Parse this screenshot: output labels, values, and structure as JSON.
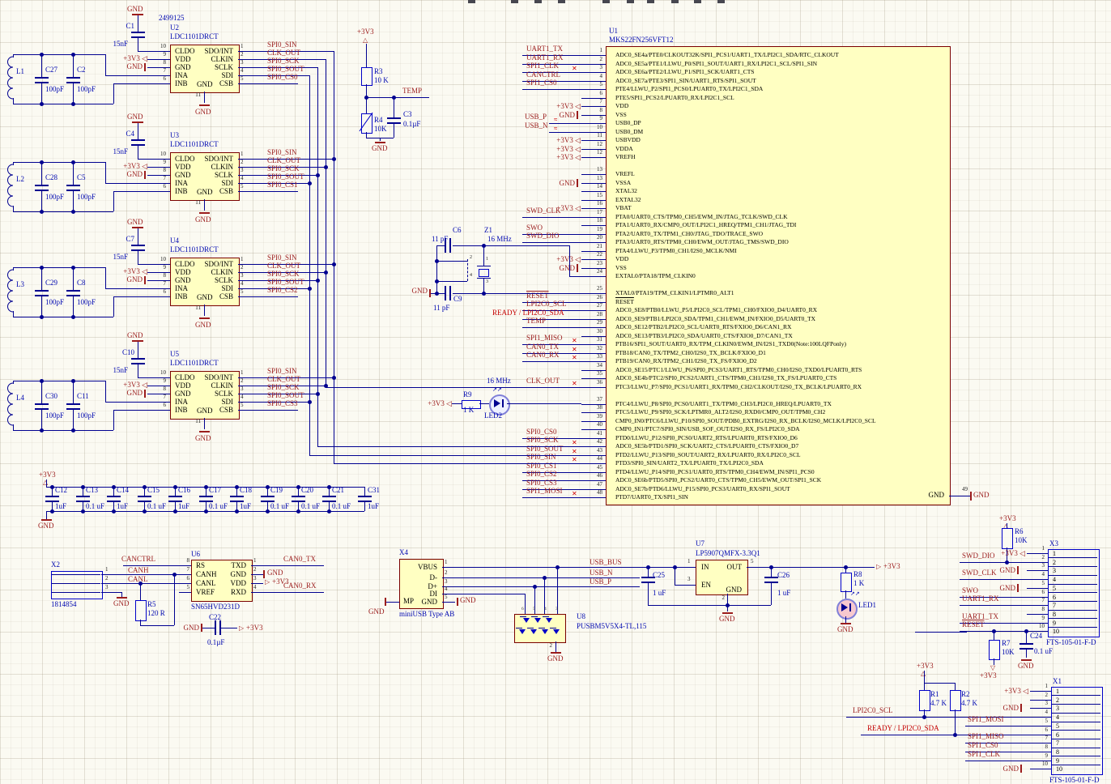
{
  "mcu": {
    "designator": "U1",
    "part": "MKS22FN256VFT12",
    "gnd_pin": {
      "num": "49",
      "name": "GND",
      "net": "GND"
    },
    "pins": [
      {
        "num": "1",
        "label": "ADC0_SE4a/PTE0/CLKOUT32K/SPI1_PCS1/UART1_TX/LPI2C1_SDA/RTC_CLKOUT",
        "net": "UART1_TX"
      },
      {
        "num": "2",
        "label": "ADC0_SE5a/PTE1/LLWU_P0/SPI1_SOUT/UART1_RX/LPI2C1_SCL/SPI1_SIN",
        "net": "UART1_RX"
      },
      {
        "num": "3",
        "label": "ADC0_SE6a/PTE2/LLWU_P1/SPI1_SCK/UART1_CTS",
        "net": "SPI1_CLK",
        "noerc": true
      },
      {
        "num": "4",
        "label": "ADC0_SE7a/PTE3/SPI1_SIN/UART1_RTS/SPI1_SOUT",
        "net": "CANCTRL"
      },
      {
        "num": "5",
        "label": "PTE4/LLWU_P2/SPI1_PCS0/LPUART0_TX/LPI2C1_SDA",
        "net": "SPI1_CS0"
      },
      {
        "num": "6",
        "label": "PTE5/SPI1_PCS2/LPUART0_RX/LPI2C1_SCL"
      },
      {
        "num": "7",
        "label": "VDD",
        "pwr": "+3V3"
      },
      {
        "num": "8",
        "label": "VSS",
        "pwr": "GND"
      },
      {
        "num": "9",
        "label": "USB0_DP",
        "net": "USB_P",
        "diff": true
      },
      {
        "num": "10",
        "label": "USB0_DM",
        "net": "USB_N",
        "diff": true
      },
      {
        "num": "11",
        "label": "USBVDD",
        "pwr": "+3V3"
      },
      {
        "num": "12",
        "label": "VDDA",
        "pwr": "+3V3"
      },
      {
        "num": "12",
        "label": "VREFH",
        "pwr": "+3V3"
      },
      {
        "gap": true
      },
      {
        "num": "13",
        "label": "VREFL"
      },
      {
        "num": "13",
        "label": "VSSA",
        "pwr": "GND"
      },
      {
        "num": "14",
        "label": "XTAL32"
      },
      {
        "num": "15",
        "label": "EXTAL32"
      },
      {
        "num": "16",
        "label": "VBAT",
        "pwr": "+3V3"
      },
      {
        "num": "17",
        "label": "PTA0/UART0_CTS/TPM0_CH5/EWM_IN/JTAG_TCLK/SWD_CLK",
        "net": "SWD_CLK"
      },
      {
        "num": "18",
        "label": "PTA1/UART0_RX/CMP0_OUT/LPI2C1_HREQ/TPM1_CH1/JTAG_TDI"
      },
      {
        "num": "19",
        "label": "PTA2/UART0_TX/TPM1_CH0/JTAG_TDO/TRACE_SWO",
        "net": "SWO"
      },
      {
        "num": "20",
        "label": "PTA3/UART0_RTS/TPM0_CH0/EWM_OUT/JTAG_TMS/SWD_DIO",
        "net": "SWD_DIO"
      },
      {
        "num": "21",
        "label": "PTA4/LLWU_P3/TPM0_CH1/I2S0_MCLK/NMI"
      },
      {
        "num": "22",
        "label": "VDD",
        "pwr": "+3V3"
      },
      {
        "num": "23",
        "label": "VSS",
        "pwr": "GND"
      },
      {
        "num": "24",
        "label": "EXTAL0/PTA18/TPM_CLKIN0",
        "ext": true
      },
      {
        "gap": true
      },
      {
        "num": "25",
        "label": "XTAL0/PTA19/TPM_CLKIN1/LPTMR0_ALT1",
        "ext": true
      },
      {
        "num": "26",
        "label": "RESET",
        "net": "RESET",
        "overline": true
      },
      {
        "num": "27",
        "label": "ADC0_SE8/PTB0/LLWU_P5/LPI2C0_SCL/TPM1_CH0/FXIO0_D4/UART0_RX",
        "net": "LPI2C0_SCL"
      },
      {
        "num": "28",
        "label": "ADC0_SE9/PTB1/LPI2C0_SDA/TPM1_CH1/EWM_IN/FXIO0_D5/UART0_TX",
        "net": "READY / LPI2C0_SDA",
        "bright": true,
        "netx": 608
      },
      {
        "num": "29",
        "label": "ADC0_SE12/PTB2/LPI2C0_SCL/UART0_RTS/FXIO0_D6/CAN1_RX",
        "net": "TEMP"
      },
      {
        "num": "30",
        "label": "ADC0_SE13/PTB3/LPI2C0_SDA/UART0_CTS/FXIO0_D7/CAN1_TX"
      },
      {
        "num": "31",
        "label": "PTB16/SPI1_SOUT/UART0_RX/TPM_CLKIN0/EWM_IN/I2S1_TXD0(Note:100LQFPonly)",
        "net": "SPI1_MISO",
        "noerc": true
      },
      {
        "num": "32",
        "label": "PTB18/CAN0_TX/TPM2_CH0/I2S0_TX_BCLK/FXIO0_D1",
        "net": "CAN0_TX",
        "noerc": true
      },
      {
        "num": "33",
        "label": "PTB19/CAN0_RX/TPM2_CH1/I2S0_TX_FS/FXIO0_D2",
        "net": "CAN0_RX",
        "noerc": true
      },
      {
        "num": "34",
        "label": "ADC0_SE15/PTC1/LLWU_P6/SPI0_PCS3/UART1_RTS/TPM0_CH0/I2S0_TXD0/LPUART0_RTS"
      },
      {
        "num": "35",
        "label": "ADC0_SE4b/PTC2/SPI0_PCS2/UART1_CTS/TPM0_CH1/I2S0_TX_FS/LPUART0_CTS"
      },
      {
        "num": "36",
        "label": "PTC3/LLWU_P7/SPI0_PCS1/UART1_RX/TPM0_CH2/CLKOUT/I2S0_TX_BCLK/LPUART0_RX",
        "net": "CLK_OUT",
        "noerc": true,
        "note": "16 MHz",
        "ext": true
      },
      {
        "gap": true
      },
      {
        "num": "37",
        "label": "PTC4/LLWU_P8/SPI0_PCS0/UART1_TX/TPM0_CH3/LPI2C0_HREQ/LPUART0_TX",
        "ext": true
      },
      {
        "num": "38",
        "label": "PTC5/LLWU_P9/SPI0_SCK/LPTMR0_ALT2/I2S0_RXD0/CMP0_OUT/TPM0_CH2"
      },
      {
        "num": "39",
        "label": "CMP0_IN0/PTC6/LLWU_P10/SPI0_SOUT/PDB0_EXTRG/I2S0_RX_BCLK/I2S0_MCLK/LPI2C0_SCL"
      },
      {
        "num": "40",
        "label": "CMP0_IN1/PTC7/SPI0_SIN/USB_SOF_OUT/I2S0_RX_FS/LPI2C0_SDA"
      },
      {
        "num": "41",
        "label": "PTD0/LLWU_P12/SPI0_PCS0/UART2_RTS/LPUART0_RTS/FXIO0_D6",
        "net": "SPI0_CS0"
      },
      {
        "num": "42",
        "label": "ADC0_SE5b/PTD1/SPI0_SCK/UART2_CTS/LPUART0_CTS/FXIO0_D7",
        "net": "SPI0_SCK",
        "noerc": true,
        "ext": true
      },
      {
        "num": "43",
        "label": "PTD2/LLWU_P13/SPI0_SOUT/UART2_RX/LPUART0_RX/LPI2C0_SCL",
        "net": "SPI0_SOUT",
        "noerc": true,
        "ext": true
      },
      {
        "num": "44",
        "label": "PTD3/SPI0_SIN/UART2_TX/LPUART0_TX/LPI2C0_SDA",
        "net": "SPI0_SIN",
        "noerc": true,
        "ext": true
      },
      {
        "num": "45",
        "label": "PTD4/LLWU_P14/SPI0_PCS1/UART0_RTS/TPM0_CH4/EWM_IN/SPI1_PCS0",
        "net": "SPI0_CS1"
      },
      {
        "num": "46",
        "label": "ADC0_SE6b/PTD5/SPI0_PCS2/UART0_CTS/TPM0_CH5/EWM_OUT/SPI1_SCK",
        "net": "SPI0_CS2"
      },
      {
        "num": "47",
        "label": "ADC0_SE7b/PTD6/LLWU_P15/SPI0_PCS3/UART0_RX/SPI1_SOUT",
        "net": "SPI0_CS3"
      },
      {
        "num": "48",
        "label": "PTD7/UART0_TX/SPI1_SIN",
        "net": "SPI1_MOSI",
        "noerc": true
      }
    ]
  },
  "sensors": [
    {
      "designator": "U2",
      "part": "LDC1101DRCT",
      "order_number": "2499125",
      "bypass_cap": {
        "ref": "C1",
        "value": "15nF"
      },
      "tank": {
        "inductor": "L1",
        "cap1": {
          "ref": "C27",
          "value": "100pF"
        },
        "cap2": {
          "ref": "C2",
          "value": "100pF"
        }
      },
      "left_pins": [
        {
          "num": "10",
          "name": "CLDO"
        },
        {
          "num": "9",
          "name": "VDD"
        },
        {
          "num": "8",
          "name": "GND"
        },
        {
          "num": "7",
          "name": "INA"
        },
        {
          "num": "6",
          "name": "INB"
        }
      ],
      "right_pins": [
        {
          "num": "1",
          "name": "SDO/INT",
          "net": "SPI0_SIN"
        },
        {
          "num": "2",
          "name": "CLKIN",
          "net": "CLK_OUT"
        },
        {
          "num": "3",
          "name": "SCLK",
          "net": "SPI0_SCK"
        },
        {
          "num": "4",
          "name": "SDI",
          "net": "SPI0_SOUT"
        },
        {
          "num": "5",
          "name": "CSB",
          "net": "SPI0_CS0"
        }
      ],
      "bottom_pin": {
        "num": "11",
        "name": "GND"
      },
      "vdd_net": "+3V3",
      "gnd_net": "GND"
    },
    {
      "designator": "U3",
      "part": "LDC1101DRCT",
      "bypass_cap": {
        "ref": "C4",
        "value": "15nF"
      },
      "tank": {
        "inductor": "L2",
        "cap1": {
          "ref": "C28",
          "value": "100pF"
        },
        "cap2": {
          "ref": "C5",
          "value": "100pF"
        }
      },
      "left_pins": [
        {
          "num": "10",
          "name": "CLDO"
        },
        {
          "num": "9",
          "name": "VDD"
        },
        {
          "num": "8",
          "name": "GND"
        },
        {
          "num": "7",
          "name": "INA"
        },
        {
          "num": "6",
          "name": "INB"
        }
      ],
      "right_pins": [
        {
          "num": "1",
          "name": "SDO/INT",
          "net": "SPI0_SIN"
        },
        {
          "num": "2",
          "name": "CLKIN",
          "net": "CLK_OUT"
        },
        {
          "num": "3",
          "name": "SCLK",
          "net": "SPI0_SCK"
        },
        {
          "num": "4",
          "name": "SDI",
          "net": "SPI0_SOUT"
        },
        {
          "num": "5",
          "name": "CSB",
          "net": "SPI0_CS1"
        }
      ],
      "bottom_pin": {
        "num": "11",
        "name": "GND"
      },
      "vdd_net": "+3V3",
      "gnd_net": "GND"
    },
    {
      "designator": "U4",
      "part": "LDC1101DRCT",
      "bypass_cap": {
        "ref": "C7",
        "value": "15nF"
      },
      "tank": {
        "inductor": "L3",
        "cap1": {
          "ref": "C29",
          "value": "100pF"
        },
        "cap2": {
          "ref": "C8",
          "value": "100pF"
        }
      },
      "left_pins": [
        {
          "num": "10",
          "name": "CLDO"
        },
        {
          "num": "9",
          "name": "VDD"
        },
        {
          "num": "8",
          "name": "GND"
        },
        {
          "num": "7",
          "name": "INA"
        },
        {
          "num": "6",
          "name": "INB"
        }
      ],
      "right_pins": [
        {
          "num": "1",
          "name": "SDO/INT",
          "net": "SPI0_SIN"
        },
        {
          "num": "2",
          "name": "CLKIN",
          "net": "CLK_OUT"
        },
        {
          "num": "3",
          "name": "SCLK",
          "net": "SPI0_SCK"
        },
        {
          "num": "4",
          "name": "SDI",
          "net": "SPI0_SOUT"
        },
        {
          "num": "5",
          "name": "CSB",
          "net": "SPI0_CS2"
        }
      ],
      "bottom_pin": {
        "num": "11",
        "name": "GND"
      },
      "vdd_net": "+3V3",
      "gnd_net": "GND"
    },
    {
      "designator": "U5",
      "part": "LDC1101DRCT",
      "bypass_cap": {
        "ref": "C10",
        "value": "15nF"
      },
      "tank": {
        "inductor": "L4",
        "cap1": {
          "ref": "C30",
          "value": "100pF"
        },
        "cap2": {
          "ref": "C11",
          "value": "100pF"
        }
      },
      "left_pins": [
        {
          "num": "10",
          "name": "CLDO"
        },
        {
          "num": "9",
          "name": "VDD"
        },
        {
          "num": "8",
          "name": "GND"
        },
        {
          "num": "7",
          "name": "INA"
        },
        {
          "num": "6",
          "name": "INB"
        }
      ],
      "right_pins": [
        {
          "num": "1",
          "name": "SDO/INT",
          "net": "SPI0_SIN"
        },
        {
          "num": "2",
          "name": "CLKIN",
          "net": "CLK_OUT"
        },
        {
          "num": "3",
          "name": "SCLK",
          "net": "SPI0_SCK"
        },
        {
          "num": "4",
          "name": "SDI",
          "net": "SPI0_SOUT"
        },
        {
          "num": "5",
          "name": "CSB",
          "net": "SPI0_CS3"
        }
      ],
      "bottom_pin": {
        "num": "11",
        "name": "GND"
      },
      "vdd_net": "+3V3",
      "gnd_net": "GND"
    }
  ],
  "temp": {
    "rail": "+3V3",
    "gnd": "GND",
    "net": "TEMP",
    "r3": {
      "ref": "R3",
      "value": "10 K"
    },
    "r4": {
      "ref": "R4",
      "value": "10K"
    },
    "c3": {
      "ref": "C3",
      "value": "0.1µF"
    }
  },
  "crystal": {
    "c6": {
      "ref": "C6",
      "value": "11 pF"
    },
    "c9": {
      "ref": "C9",
      "value": "11 pF"
    },
    "xtal": {
      "ref": "Z1",
      "value": "16 MHz"
    },
    "pin_nums": [
      "2",
      "1",
      "4",
      "3"
    ],
    "gnd": "GND"
  },
  "clk_led": {
    "rail": "+3V3",
    "r9": {
      "ref": "R9",
      "value": "1 K"
    },
    "led": "LED2",
    "note": "16 MHz"
  },
  "cap_bank": {
    "rail": "+3V3",
    "gnd": "GND",
    "caps": [
      {
        "ref": "C12",
        "value": "1uF"
      },
      {
        "ref": "C13",
        "value": "0.1 uF"
      },
      {
        "ref": "C14",
        "value": "1uF"
      },
      {
        "ref": "C15",
        "value": "0.1 uF"
      },
      {
        "ref": "C16",
        "value": "1uF"
      },
      {
        "ref": "C17",
        "value": "0.1 uF"
      },
      {
        "ref": "C18",
        "value": "1uF"
      },
      {
        "ref": "C19",
        "value": "0.1 uF"
      },
      {
        "ref": "C20",
        "value": "0.1 uF"
      },
      {
        "ref": "C21",
        "value": "0.1 uF"
      },
      {
        "ref": "C31",
        "value": "1uF"
      }
    ]
  },
  "can": {
    "rail": "+3V3",
    "gnd": "GND",
    "x2": {
      "ref": "X2",
      "part": "1814854",
      "pin_nums": [
        "1",
        "2",
        "3"
      ]
    },
    "nets": {
      "canctrl": "CANCTRL",
      "canh": "CANH",
      "canl": "CANL",
      "tx": "CAN0_TX",
      "rx": "CAN0_RX"
    },
    "r5": {
      "ref": "R5",
      "value": "120 R"
    },
    "u6": {
      "ref": "U6",
      "part": "SN65HVD231D",
      "left": [
        {
          "num": "8",
          "name": "RS"
        },
        {
          "num": "7",
          "name": "CANH"
        },
        {
          "num": "6",
          "name": "CANL"
        },
        {
          "num": "5",
          "name": "VREF"
        }
      ],
      "right": [
        {
          "num": "1",
          "name": "TXD"
        },
        {
          "num": "2",
          "name": "GND"
        },
        {
          "num": "3",
          "name": "VDD"
        },
        {
          "num": "4",
          "name": "RXD"
        }
      ]
    },
    "c22": {
      "ref": "C22",
      "value": "0.1µF"
    }
  },
  "usb": {
    "gnd": "GND",
    "x4": {
      "ref": "X4",
      "part": "miniUSB Type AB",
      "mp": "MP",
      "right": [
        {
          "num": "1",
          "name": "VBUS"
        },
        {
          "num": "2",
          "name": "D-"
        },
        {
          "num": "3",
          "name": "D+"
        },
        {
          "num": "4",
          "name": "DI"
        },
        {
          "num": "5",
          "name": "GND"
        }
      ]
    },
    "nets": {
      "bus": "USB_BUS",
      "n": "USB_N",
      "p": "USB_P"
    },
    "u8": {
      "ref": "U8",
      "part": "PUSBM5V5X4-TL,115",
      "top_nums": [
        "6",
        "5",
        "4",
        "3"
      ],
      "gnd_num": "2"
    }
  },
  "reg": {
    "rail": "+3V3",
    "gnd": "GND",
    "led": "LED1",
    "u7": {
      "ref": "U7",
      "part": "LP5907QMFX-3.3Q1",
      "pins": {
        "in": {
          "num": "1",
          "name": "IN"
        },
        "en": {
          "num": "3",
          "name": "EN"
        },
        "out": {
          "num": "5",
          "name": "OUT"
        },
        "gnd": {
          "num": "2",
          "name": "GND"
        }
      }
    },
    "c25": {
      "ref": "C25",
      "value": "1 uF"
    },
    "c26": {
      "ref": "C26",
      "value": "1 uF"
    },
    "r8": {
      "ref": "R8",
      "value": "1 K"
    }
  },
  "swd": {
    "rail": "+3V3",
    "gnd": "GND",
    "r6": {
      "ref": "R6",
      "value": "10K"
    },
    "r7": {
      "ref": "R7",
      "value": "10K"
    },
    "c24": {
      "ref": "C24",
      "value": "0.1 uF"
    },
    "x3": {
      "ref": "X3",
      "part": "FTS-105-01-F-D",
      "pins": [
        {
          "num": "1",
          "pwr": "+3V3"
        },
        {
          "num": "2",
          "net": "SWD_DIO"
        },
        {
          "num": "3",
          "pwr": "GND"
        },
        {
          "num": "4",
          "net": "SWD_CLK"
        },
        {
          "num": "5",
          "pwr": "GND"
        },
        {
          "num": "6",
          "net": "SWO"
        },
        {
          "num": "7",
          "net": "UART1_RX"
        },
        {
          "num": "8"
        },
        {
          "num": "9",
          "net": "UART1_TX"
        },
        {
          "num": "10",
          "net": "RESET",
          "overline": true
        }
      ]
    }
  },
  "spi_header": {
    "rail": "+3V3",
    "gnd": "GND",
    "r1": {
      "ref": "R1",
      "value": "4.7 K"
    },
    "r2": {
      "ref": "R2",
      "value": "4.7 K"
    },
    "x1": {
      "ref": "X1",
      "part": "FTS-105-01-F-D",
      "pins": [
        {
          "num": "1",
          "pwr": "+3V3"
        },
        {
          "num": "2"
        },
        {
          "num": "3",
          "pwr": "GND"
        },
        {
          "num": "4",
          "net": "LPI2C0_SCL",
          "long": true
        },
        {
          "num": "5",
          "net": "SPI1_MOSI"
        },
        {
          "num": "6",
          "net": "READY / LPI2C0_SDA",
          "long": true,
          "bright": true
        },
        {
          "num": "7",
          "net": "SPI1_MISO"
        },
        {
          "num": "8",
          "net": "SPI1_CS0"
        },
        {
          "num": "9",
          "net": "SPI1_CLK"
        },
        {
          "num": "10",
          "pwr": "GND"
        }
      ]
    }
  }
}
